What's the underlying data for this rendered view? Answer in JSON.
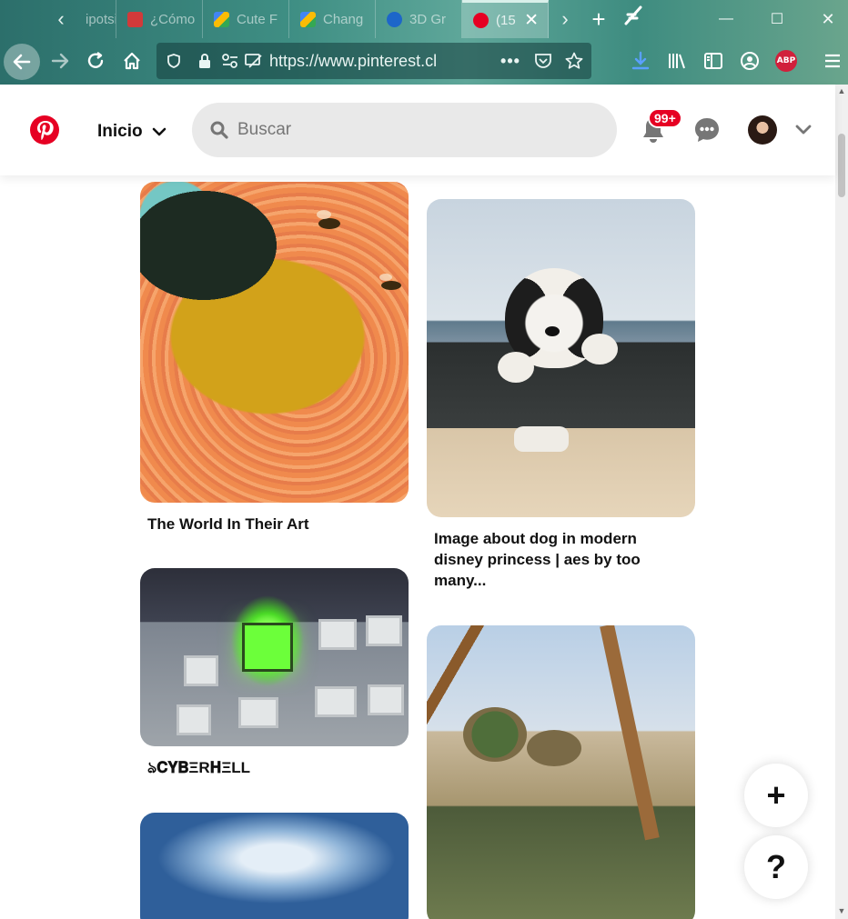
{
  "browser": {
    "tabs": [
      {
        "title": "ipotsi",
        "fav_color": "#7c8a8d"
      },
      {
        "title": "¿Cómo",
        "fav_color": "#d13a3a"
      },
      {
        "title": "Cute F",
        "fav_color": "#f2b01e"
      },
      {
        "title": "Chang",
        "fav_color": "#f2b01e"
      },
      {
        "title": "3D Gr",
        "fav_color": "#2a6fd6"
      },
      {
        "title": "(15",
        "fav_color": "#e60023",
        "active": true
      }
    ],
    "url": "https://www.pinterest.cl"
  },
  "header": {
    "home_label": "Inicio",
    "search_placeholder": "Buscar",
    "notification_badge": "99+"
  },
  "pins": [
    {
      "title": "The World In Their Art"
    },
    {
      "title": "Image about dog in modern disney princess | aes by too many..."
    },
    {
      "title": "ঌ𝐂𝐘𝐁ΞR𝐇ΞLL"
    },
    {
      "title": ""
    },
    {
      "title": ""
    }
  ],
  "fab": {
    "add": "+",
    "help": "?"
  },
  "colors": {
    "brand": "#e60023",
    "search_bg": "#e9e9e9",
    "badge_bg": "#e60023"
  }
}
